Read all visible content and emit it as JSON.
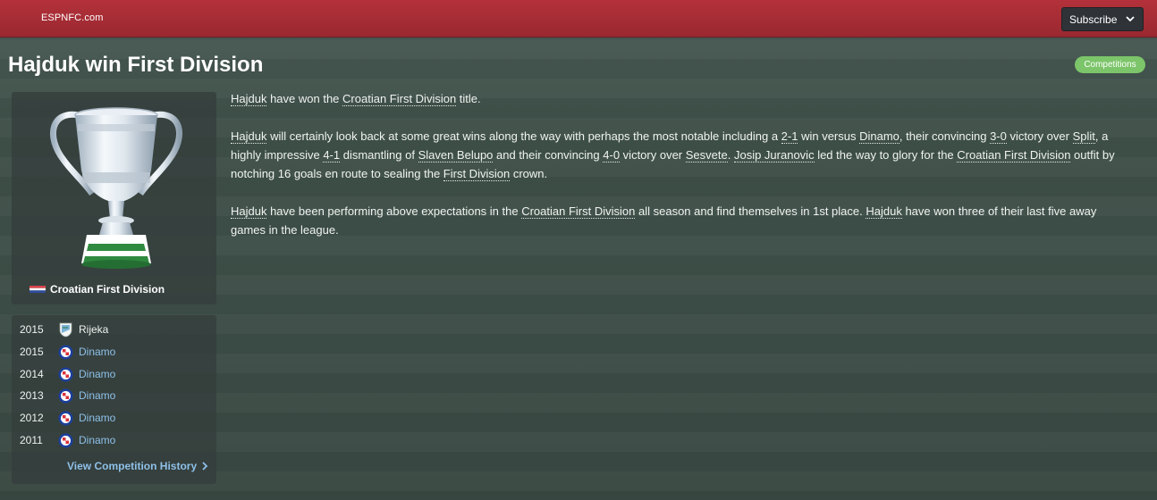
{
  "header": {
    "brand": "ESPNFC.com",
    "subscribe_label": "Subscribe",
    "colors": {
      "bar": "#a62d35",
      "button": "#2f3338"
    }
  },
  "article": {
    "title": "Hajduk win First Division",
    "category_tag": "Competitions",
    "category_color": "#7cc56a",
    "p1": {
      "t1": "Hajduk",
      "t2": " have won the ",
      "t3": "Croatian First Division",
      "t4": " title."
    },
    "p2": {
      "t1": "Hajduk",
      "t2": " will certainly look back at some great wins along the way with perhaps the most notable including a ",
      "t3": "2-1",
      "t4": " win versus ",
      "t5": "Dinamo",
      "t6": ", their convincing ",
      "t7": "3-0",
      "t8": " victory over ",
      "t9": "Split",
      "t10": ", a highly impressive ",
      "t11": "4-1",
      "t12": " dismantling of ",
      "t13": "Slaven Belupo",
      "t14": " and their convincing ",
      "t15": "4-0",
      "t16": " victory over ",
      "t17": "Sesvete",
      "t18": ". ",
      "t19": "Josip Juranovic",
      "t20": " led the way to glory for the ",
      "t21": "Croatian First Division",
      "t22": " outfit by notching 16 goals en route to sealing the ",
      "t23": "First Division",
      "t24": " crown."
    },
    "p3": {
      "t1": "Hajduk",
      "t2": " have been performing above expectations in the ",
      "t3": "Croatian First Division",
      "t4": " all season and find themselves in 1st place. ",
      "t5": "Hajduk",
      "t6": " have won three of their last five away games in the league."
    }
  },
  "competition": {
    "name": "Croatian First Division",
    "trophy_icon": "trophy-icon",
    "flag_icon": "croatia-flag-icon"
  },
  "history": {
    "rows": [
      {
        "year": "2015",
        "team": "Rijeka",
        "badge": "rijeka-badge-icon"
      },
      {
        "year": "2015",
        "team": "Dinamo",
        "badge": "dinamo-badge-icon"
      },
      {
        "year": "2014",
        "team": "Dinamo",
        "badge": "dinamo-badge-icon"
      },
      {
        "year": "2013",
        "team": "Dinamo",
        "badge": "dinamo-badge-icon"
      },
      {
        "year": "2012",
        "team": "Dinamo",
        "badge": "dinamo-badge-icon"
      },
      {
        "year": "2011",
        "team": "Dinamo",
        "badge": "dinamo-badge-icon"
      }
    ],
    "view_link": "View Competition History"
  }
}
